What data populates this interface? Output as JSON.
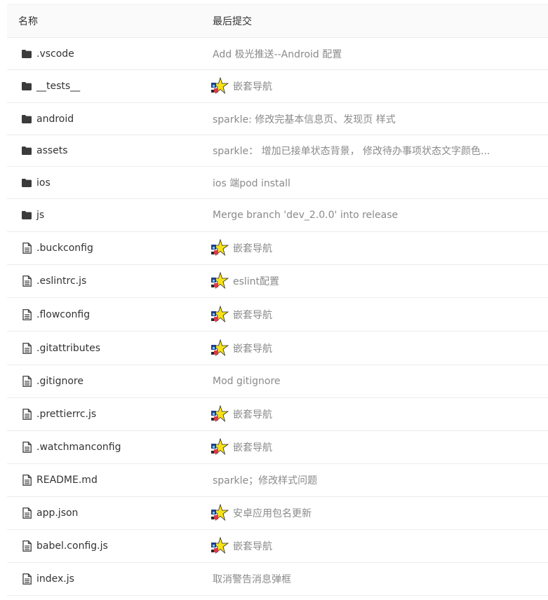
{
  "header": {
    "name_label": "名称",
    "commit_label": "最后提交"
  },
  "rows": [
    {
      "name": ".vscode",
      "type": "folder",
      "commit": "Add 极光推送--Android 配置",
      "avatar": false
    },
    {
      "name": "__tests__",
      "type": "folder",
      "commit": "嵌套导航",
      "avatar": true
    },
    {
      "name": "android",
      "type": "folder",
      "commit": "sparkle: 修改完基本信息页、发现页 样式",
      "avatar": false
    },
    {
      "name": "assets",
      "type": "folder",
      "commit": "sparkle： 增加已接单状态背景， 修改待办事项状态文字颜色...",
      "avatar": false
    },
    {
      "name": "ios",
      "type": "folder",
      "commit": "ios 端pod install",
      "avatar": false
    },
    {
      "name": "js",
      "type": "folder",
      "commit": "Merge branch 'dev_2.0.0' into release",
      "avatar": false
    },
    {
      "name": ".buckconfig",
      "type": "file",
      "commit": "嵌套导航",
      "avatar": true
    },
    {
      "name": ".eslintrc.js",
      "type": "file",
      "commit": "eslint配置",
      "avatar": true
    },
    {
      "name": ".flowconfig",
      "type": "file",
      "commit": "嵌套导航",
      "avatar": true
    },
    {
      "name": ".gitattributes",
      "type": "file",
      "commit": "嵌套导航",
      "avatar": true
    },
    {
      "name": ".gitignore",
      "type": "file",
      "commit": "Mod gitignore",
      "avatar": false
    },
    {
      "name": ".prettierrc.js",
      "type": "file",
      "commit": "嵌套导航",
      "avatar": true
    },
    {
      "name": ".watchmanconfig",
      "type": "file",
      "commit": "嵌套导航",
      "avatar": true
    },
    {
      "name": "README.md",
      "type": "file",
      "commit": "sparkle；修改样式问题",
      "avatar": false
    },
    {
      "name": "app.json",
      "type": "file",
      "commit": "安卓应用包名更新",
      "avatar": true
    },
    {
      "name": "babel.config.js",
      "type": "file",
      "commit": "嵌套导航",
      "avatar": true
    },
    {
      "name": "index.js",
      "type": "file",
      "commit": "取消警告消息弹框",
      "avatar": false
    }
  ],
  "icons": {
    "folder": "folder-icon",
    "file": "file-icon",
    "avatar": "avatar-icon"
  },
  "colors": {
    "text": "#333333",
    "muted": "#8a8a8a",
    "border": "#ececec",
    "header_bg": "#fafafa"
  }
}
